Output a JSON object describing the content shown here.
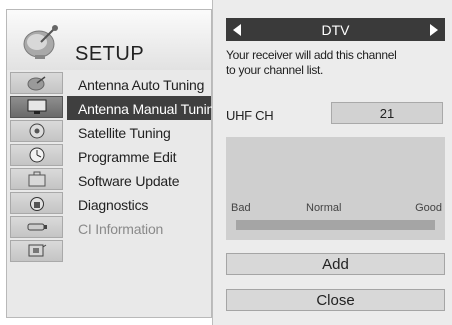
{
  "setup": {
    "title": "SETUP",
    "menu": [
      {
        "label": "Antenna Auto Tuning",
        "icon": "antenna-dish-icon",
        "state": "normal"
      },
      {
        "label": "Antenna Manual Tuning",
        "icon": "tv-monitor-icon",
        "state": "selected"
      },
      {
        "label": "Satellite Tuning",
        "icon": "disc-icon",
        "state": "normal"
      },
      {
        "label": "Programme Edit",
        "icon": "clock-icon",
        "state": "normal"
      },
      {
        "label": "Software Update",
        "icon": "briefcase-icon",
        "state": "normal"
      },
      {
        "label": "Diagnostics",
        "icon": "lock-icon",
        "state": "normal"
      },
      {
        "label": "CI Information",
        "icon": "ci-card-icon",
        "state": "disabled"
      }
    ],
    "extra_icon": "media-setup-icon"
  },
  "dialog": {
    "mode": "DTV",
    "info_line1": "Your receiver will add this channel",
    "info_line2": "to your channel list.",
    "channel_label": "UHF CH",
    "channel_value": "21",
    "signal": {
      "bad_label": "Bad",
      "normal_label": "Normal",
      "good_label": "Good",
      "level": 0
    },
    "add_label": "Add",
    "close_label": "Close"
  },
  "colors": {
    "selected_bg": "#3f3f3f",
    "panel_bg": "#e9e9e9",
    "dialog_bg": "#ececec"
  }
}
